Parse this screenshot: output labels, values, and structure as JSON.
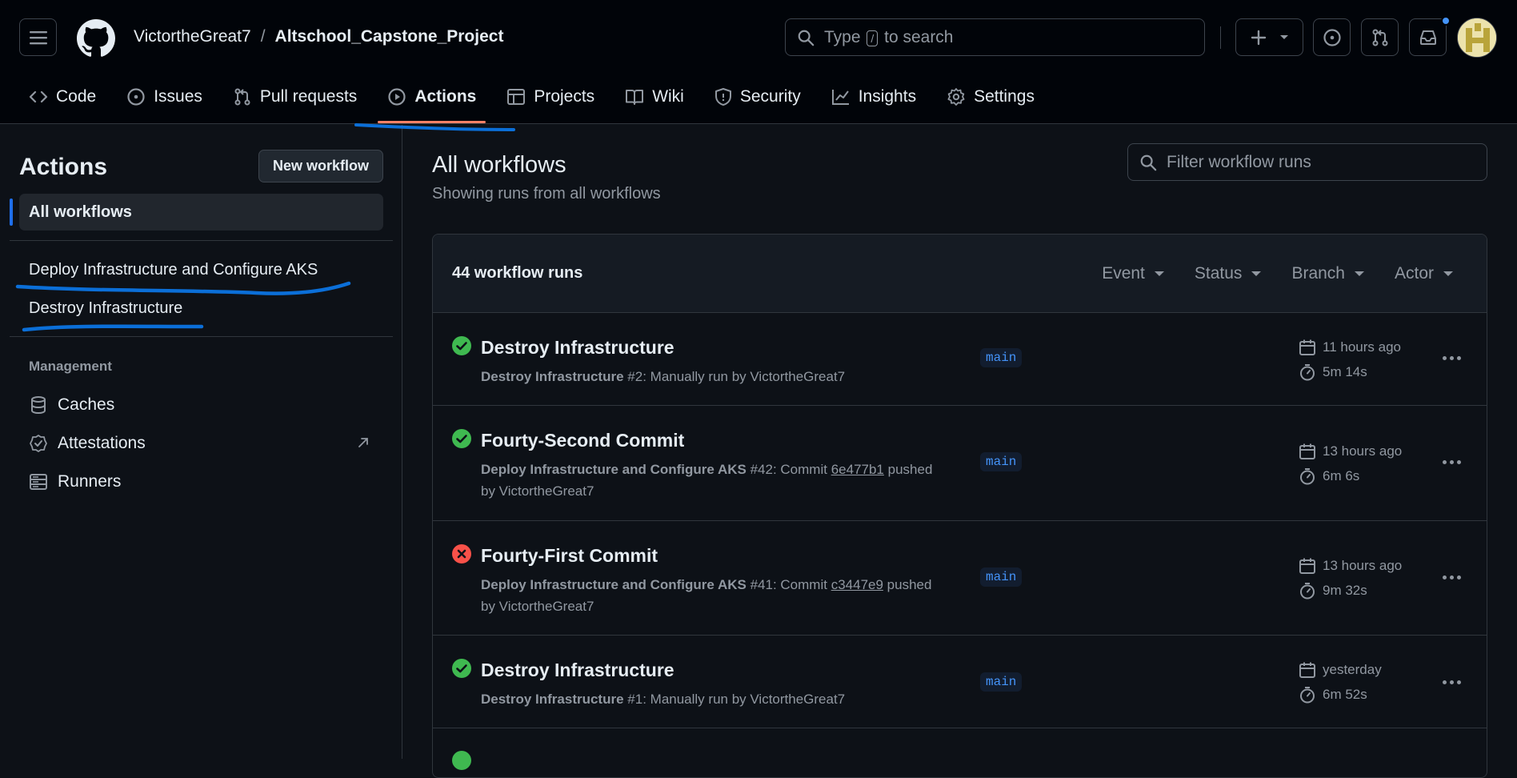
{
  "header": {
    "owner": "VictortheGreat7",
    "separator": "/",
    "repo": "Altschool_Capstone_Project",
    "search_pre": "Type",
    "search_key": "/",
    "search_post": "to search"
  },
  "tabs": [
    {
      "label": "Code",
      "icon": "code-icon"
    },
    {
      "label": "Issues",
      "icon": "issue-icon"
    },
    {
      "label": "Pull requests",
      "icon": "pull-request-icon"
    },
    {
      "label": "Actions",
      "icon": "play-icon",
      "active": true
    },
    {
      "label": "Projects",
      "icon": "table-icon"
    },
    {
      "label": "Wiki",
      "icon": "book-icon"
    },
    {
      "label": "Security",
      "icon": "shield-icon"
    },
    {
      "label": "Insights",
      "icon": "graph-icon"
    },
    {
      "label": "Settings",
      "icon": "gear-icon"
    }
  ],
  "sidebar": {
    "title": "Actions",
    "new_workflow": "New workflow",
    "all_workflows": "All workflows",
    "workflows": [
      "Deploy Infrastructure and Configure AKS",
      "Destroy Infrastructure"
    ],
    "management_label": "Management",
    "management": [
      {
        "label": "Caches",
        "icon": "database-icon"
      },
      {
        "label": "Attestations",
        "icon": "verified-icon"
      },
      {
        "label": "Runners",
        "icon": "server-icon"
      }
    ]
  },
  "main": {
    "title": "All workflows",
    "subtitle": "Showing runs from all workflows",
    "filter_placeholder": "Filter workflow runs",
    "runs_count": "44 workflow runs",
    "filters": [
      "Event",
      "Status",
      "Branch",
      "Actor"
    ]
  },
  "runs": [
    {
      "status": "success",
      "title": "Destroy Infrastructure",
      "workflow": "Destroy Infrastructure",
      "meta1": "#2: Manually run by VictortheGreat7",
      "sha": "",
      "meta2": "",
      "meta3": "",
      "branch": "main",
      "when": "11 hours ago",
      "duration": "5m 14s"
    },
    {
      "status": "success",
      "title": "Fourty-Second Commit",
      "workflow": "Deploy Infrastructure and Configure AKS",
      "meta1": "#42: Commit",
      "sha": "6e477b1",
      "meta2": "pushed",
      "meta3": "by VictortheGreat7",
      "branch": "main",
      "when": "13 hours ago",
      "duration": "6m 6s"
    },
    {
      "status": "failure",
      "title": "Fourty-First Commit",
      "workflow": "Deploy Infrastructure and Configure AKS",
      "meta1": "#41: Commit",
      "sha": "c3447e9",
      "meta2": "pushed",
      "meta3": "by VictortheGreat7",
      "branch": "main",
      "when": "13 hours ago",
      "duration": "9m 32s"
    },
    {
      "status": "success",
      "title": "Destroy Infrastructure",
      "workflow": "Destroy Infrastructure",
      "meta1": "#1: Manually run by VictortheGreat7",
      "sha": "",
      "meta2": "",
      "meta3": "",
      "branch": "main",
      "when": "yesterday",
      "duration": "6m 52s"
    }
  ],
  "colors": {
    "success": "#3fb950",
    "failure": "#f85149",
    "accent": "#1f6feb",
    "active_tab": "#f78166",
    "annotation": "#0b6fd8"
  }
}
